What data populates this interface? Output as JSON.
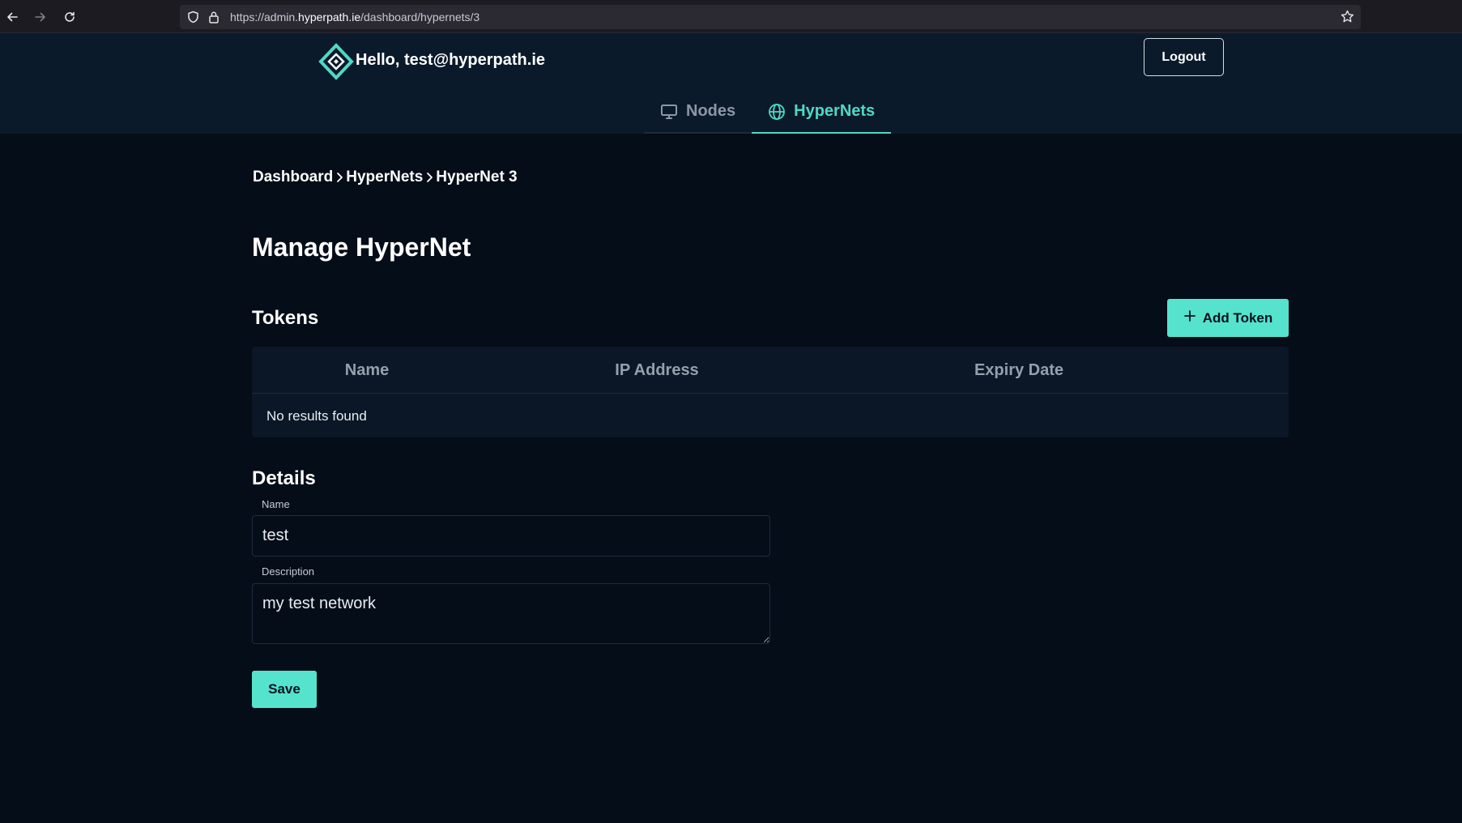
{
  "browser": {
    "url_prefix": "https://admin.",
    "url_domain": "hyperpath.ie",
    "url_path": "/dashboard/hypernets/3"
  },
  "header": {
    "greeting": "Hello, test@hyperpath.ie",
    "logout_label": "Logout",
    "brand_color": "#4fd8c5"
  },
  "tabs": [
    {
      "label": "Nodes",
      "icon": "monitor-icon",
      "active": false
    },
    {
      "label": "HyperNets",
      "icon": "globe-icon",
      "active": true
    }
  ],
  "breadcrumb": [
    "Dashboard",
    "HyperNets",
    "HyperNet 3"
  ],
  "page": {
    "title": "Manage HyperNet"
  },
  "tokens": {
    "title": "Tokens",
    "add_label": "Add Token",
    "columns": [
      "Name",
      "IP Address",
      "Expiry Date"
    ],
    "empty_text": "No results found"
  },
  "details": {
    "title": "Details",
    "name_label": "Name",
    "name_value": "test",
    "description_label": "Description",
    "description_value": "my test network",
    "save_label": "Save"
  },
  "colors": {
    "accent": "#55e3cd",
    "background": "#050d18",
    "header_bg": "#0b1a2b"
  }
}
